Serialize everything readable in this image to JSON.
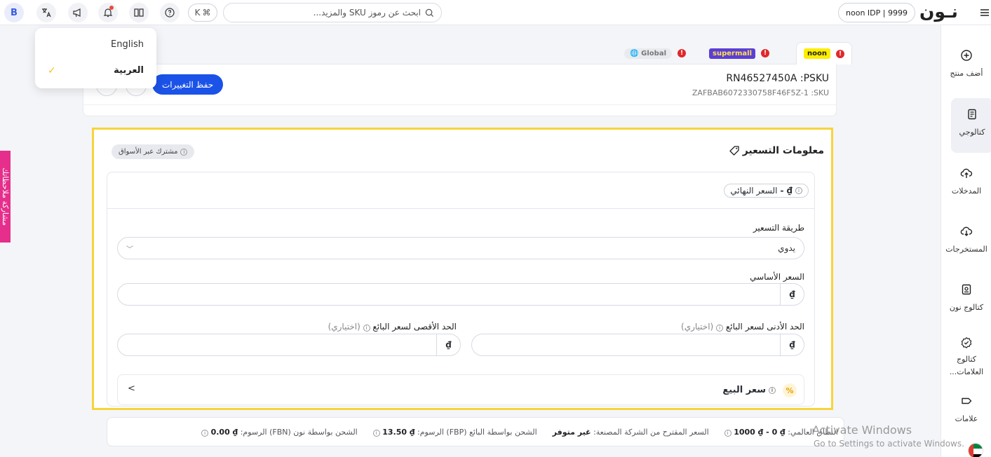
{
  "topbar": {
    "avatar_letter": "B",
    "kbd_k": "K",
    "kbd_cmd": "⌘",
    "search_placeholder": "ابحث عن رموز SKU والمزيد...",
    "partner": "noon IDP | 9999",
    "brand": "نـون"
  },
  "language_menu": {
    "options": [
      "English",
      "العربية"
    ],
    "selected": "العربية",
    "check": "✓"
  },
  "sidebar": {
    "items": [
      {
        "label": "أضف منتج",
        "icon": "plus-circle-icon"
      },
      {
        "label": "كتالوجي",
        "icon": "catalog-icon"
      },
      {
        "label": "المدخلات",
        "icon": "cloud-upload-icon"
      },
      {
        "label": "المستخرجات",
        "icon": "cloud-download-icon"
      },
      {
        "label": "كتالوج نون",
        "icon": "book-icon"
      },
      {
        "label_line1": "كتالوج",
        "label_line2": "العلامات...",
        "icon": "badge-check-icon"
      },
      {
        "label": "علامات",
        "icon": "tag-icon"
      }
    ]
  },
  "pink_tab": "مشاركة ملاحظاتك",
  "marketplaces": {
    "noon": "noon",
    "supermall": "supermall",
    "global": "Global",
    "alert": "!"
  },
  "product": {
    "psku": "RN46527450A :PSKU",
    "sku": "ZAFBAB6072330758F46F5Z-1 :SKU",
    "save_label": "حفظ التغييرات"
  },
  "pricing": {
    "title": "معلومات التسعير",
    "shared_badge": "مشترك عبر الأسواق",
    "final_price_label": "السعر النهائي",
    "final_price_value": "- ₫",
    "method_label": "طريقة التسعير",
    "method_value": "يدوي",
    "base_price_label": "السعر الأساسي",
    "min_price_label": "الحد الأدنى لسعر البائع",
    "max_price_label": "الحد الأقصى لسعر البائع",
    "optional": "(اختياري)",
    "currency": "₫",
    "sale_price_label": "سعر البيع",
    "pct": "%",
    "chevron": "<",
    "info": "i"
  },
  "infobar": {
    "global_range_label": "النطاق العالمي:",
    "global_range_value": "₫ 0 - ₫ 1000",
    "msrp_label": "السعر المقترح من الشركة المصنعة:",
    "msrp_value": "غير متوفر",
    "fbp_label": "الشحن بواسطة البائع (FBP) الرسوم:",
    "fbp_value": "₫ 13.50",
    "fbn_label": "الشحن بواسطة نون (FBN) الرسوم:",
    "fbn_value": "₫ 0.00"
  },
  "watermark": {
    "line1": "Activate Windows",
    "line2": "Go to Settings to activate Windows."
  },
  "colors": {
    "accent": "#1b52e7",
    "highlight": "#f7d43a",
    "pink": "#e62f8c",
    "noon_yellow": "#feee00"
  }
}
